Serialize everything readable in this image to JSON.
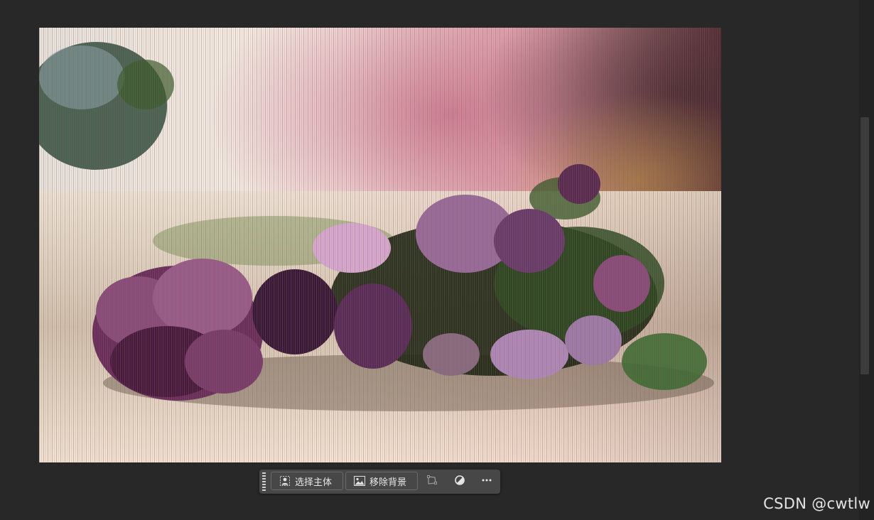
{
  "canvas": {
    "image_description_icon": "flower-bouquet-photo",
    "colors": {
      "background": "#282828",
      "image_base": "#f1ddd0",
      "flowers": "#6b2d5c",
      "foliage": "#3d5a2a"
    }
  },
  "taskbar": {
    "select_subject_label": "选择主体",
    "select_subject_icon": "person-icon",
    "remove_background_label": "移除背景",
    "remove_background_icon": "image-icon",
    "transform_icon": "transform-icon",
    "adjust_icon": "adjustment-icon",
    "more_icon": "more-icon"
  },
  "watermark": {
    "text": "CSDN @cwtlw"
  }
}
